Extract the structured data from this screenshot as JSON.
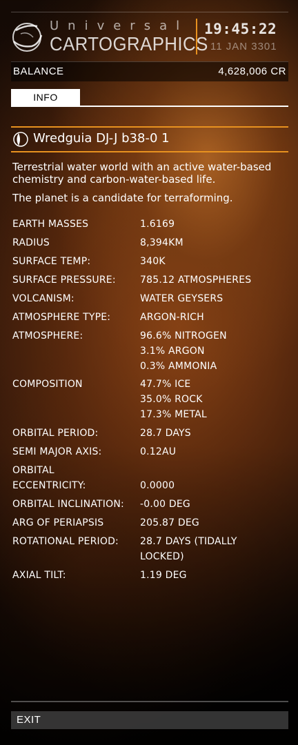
{
  "header": {
    "brand_top": "Universal",
    "brand_bottom": "CARTOGRAPHICS",
    "time": "19:45:22",
    "date": "11 JAN 3301",
    "logo_icon": "universal-cartographics-logo-icon"
  },
  "balance": {
    "label": "BALANCE",
    "value": "4,628,006 CR"
  },
  "tabs": [
    {
      "label": "INFO",
      "active": true
    }
  ],
  "planet": {
    "icon": "planet-icon",
    "name": "Wredguia DJ-J b38-0 1",
    "description_1": "Terrestrial water world with an active water-based chemistry and carbon-water-based life.",
    "description_2": "The planet is a candidate for terraforming."
  },
  "stats": [
    {
      "key": "EARTH MASSES",
      "values": [
        "1.6169"
      ]
    },
    {
      "key": "RADIUS",
      "values": [
        "8,394KM"
      ]
    },
    {
      "key": "SURFACE TEMP:",
      "values": [
        "340K"
      ]
    },
    {
      "key": "SURFACE PRESSURE:",
      "values": [
        "785.12 ATMOSPHERES"
      ]
    },
    {
      "key": "VOLCANISM:",
      "values": [
        "WATER GEYSERS"
      ]
    },
    {
      "key": "ATMOSPHERE TYPE:",
      "values": [
        "ARGON-RICH"
      ]
    },
    {
      "key": "ATMOSPHERE:",
      "values": [
        "96.6% NITROGEN",
        "3.1% ARGON",
        "0.3% AMMONIA"
      ]
    },
    {
      "key": "COMPOSITION",
      "values": [
        "47.7% ICE",
        "35.0% ROCK",
        "17.3% METAL"
      ]
    },
    {
      "key": "ORBITAL PERIOD:",
      "values": [
        "28.7 DAYS"
      ]
    },
    {
      "key": "SEMI MAJOR AXIS:",
      "values": [
        "0.12AU"
      ]
    },
    {
      "key": "ORBITAL ECCENTRICITY:",
      "key_lines": [
        "ORBITAL",
        "ECCENTRICITY:"
      ],
      "values": [
        "0.0000"
      ]
    },
    {
      "key": "ORBITAL INCLINATION:",
      "values": [
        "-0.00 DEG"
      ]
    },
    {
      "key": "ARG OF PERIAPSIS",
      "values": [
        "205.87 DEG"
      ]
    },
    {
      "key": "ROTATIONAL PERIOD:",
      "values": [
        "28.7 DAYS (TIDALLY",
        "LOCKED)"
      ]
    },
    {
      "key": "AXIAL TILT:",
      "values": [
        "1.19 DEG"
      ]
    }
  ],
  "footer": {
    "exit_label": "EXIT"
  },
  "colors": {
    "accent": "#e8921f",
    "text": "#ffffff",
    "tab_active_bg": "#ffffff",
    "exit_bg": "#464646"
  }
}
